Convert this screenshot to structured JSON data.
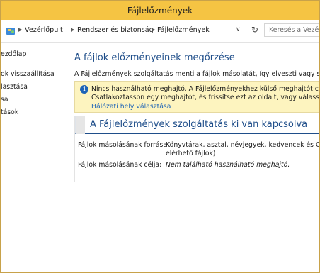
{
  "window": {
    "title": "Fájlelőzmények"
  },
  "address": {
    "crumbs": [
      "Vezérlőpult",
      "Rendszer és biztonság",
      "Fájlelőzmények"
    ],
    "search_placeholder": "Keresés a Vezérlőpulton"
  },
  "sidebar": {
    "items": [
      {
        "label": "ezdőlap"
      },
      {
        "label": "ok visszaállítása"
      },
      {
        "label": "lasztása"
      },
      {
        "label": "sa"
      },
      {
        "label": "tások"
      }
    ]
  },
  "main": {
    "heading": "A fájlok előzményeinek megőrzése",
    "description": "A Fájlelőzmények szolgáltatás menti a fájlok másolatát, így elveszti vagy sérülés ese",
    "warning": {
      "line1": "Nincs használható meghajtó. A Fájlelőzményekhez külső meghajtót célszerű ha",
      "line2": "Csatlakoztasson egy meghajtót, és frissítse ezt az oldalt, vagy válasszon egy hál",
      "link": "Hálózati hely választása"
    },
    "status_panel": {
      "title": "A Fájlelőzmények szolgáltatás ki van kapcsolva",
      "source_label": "Fájlok másolásának forrása:",
      "source_value_line1": "Könyvtárak, asztal, névjegyek, kedvencek és OneDrive",
      "source_value_line2": "elérhető fájlok)",
      "target_label": "Fájlok másolásának célja:",
      "target_value": "Nem található használható meghajtó."
    }
  },
  "colors": {
    "titlebar": "#f5c443",
    "heading": "#1f4e8a",
    "link": "#1c63b7",
    "warning_bg": "#fdf4bf"
  }
}
